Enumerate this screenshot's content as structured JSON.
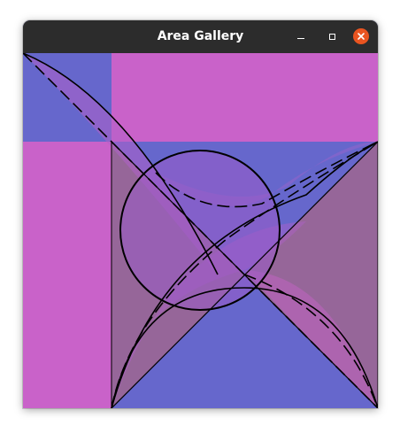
{
  "window": {
    "title": "Area Gallery",
    "buttons": {
      "minimize": "minimize-icon",
      "maximize": "maximize-icon",
      "close": "close-icon"
    }
  },
  "colors": {
    "titlebar": "#2c2c2c",
    "title_text": "#ffffff",
    "close_button": "#e95420",
    "blue_fill": "#6667cc",
    "magenta_fill": "#c962c9",
    "mauve_fill": "#966699",
    "purple_overlay": "#9b5bc9",
    "stroke": "#000000"
  }
}
